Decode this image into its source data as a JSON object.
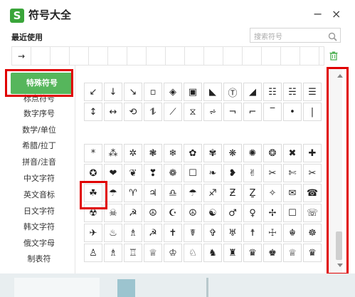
{
  "window": {
    "title": "符号大全",
    "logo_letter": "S",
    "minimize_label": "−",
    "close_label": "×"
  },
  "recent": {
    "label": "最近使用",
    "items": [
      "→",
      "",
      "",
      "",
      "",
      "",
      "",
      "",
      "",
      "",
      "",
      "",
      "",
      "",
      "",
      ""
    ]
  },
  "search": {
    "placeholder": "搜索符号"
  },
  "sidebar": {
    "items": [
      {
        "label": "特殊符号",
        "active": true
      },
      {
        "label": "标点符号",
        "active": false
      },
      {
        "label": "数字序号",
        "active": false
      },
      {
        "label": "数学/单位",
        "active": false
      },
      {
        "label": "希腊/拉丁",
        "active": false
      },
      {
        "label": "拼音/注音",
        "active": false
      },
      {
        "label": "中文字符",
        "active": false
      },
      {
        "label": "英文音标",
        "active": false
      },
      {
        "label": "日文字符",
        "active": false
      },
      {
        "label": "韩文字符",
        "active": false
      },
      {
        "label": "俄文字母",
        "active": false
      },
      {
        "label": "制表符",
        "active": false
      }
    ]
  },
  "grid": {
    "section1": [
      [
        "↙",
        "↓",
        "↘",
        "▫",
        "◈",
        "▣",
        "◣",
        "Ⓣ",
        "◢",
        "☷",
        "☵",
        "☰"
      ],
      [
        "↕",
        "↔",
        "⟲",
        "⥮",
        "⟋",
        "⧖",
        "⩫",
        "¬",
        "⌐",
        "‾",
        "•",
        "|"
      ]
    ],
    "section2": [
      [
        "*",
        "⁂",
        "✲",
        "❃",
        "❄",
        "✿",
        "✾",
        "❋",
        "✺",
        "❂",
        "✖",
        "✚"
      ],
      [
        "✪",
        "❤",
        "❦",
        "❣",
        "❁",
        "☐",
        "❧",
        "❥",
        "✌",
        "✂",
        "✄",
        "✂"
      ],
      [
        "☘",
        "☂",
        "♈",
        "♃",
        "♎",
        "☂",
        "♐",
        "Ƶ",
        "Ẕ",
        "✧",
        "✉",
        "☎"
      ],
      [
        "☢",
        "☠",
        "☭",
        "☮",
        "☪",
        "☮",
        "☯",
        "♂",
        "♀",
        "✢",
        "☐",
        "☏"
      ],
      [
        "✈",
        "♨",
        "♗",
        "☭",
        "✝",
        "☤",
        "✞",
        "♅",
        "☨",
        "☩",
        "☬",
        "☸"
      ],
      [
        "♙",
        "♗",
        "♖",
        "♕",
        "♔",
        "♘",
        "♞",
        "♜",
        "♛",
        "♚",
        "♕",
        "♛"
      ]
    ]
  }
}
